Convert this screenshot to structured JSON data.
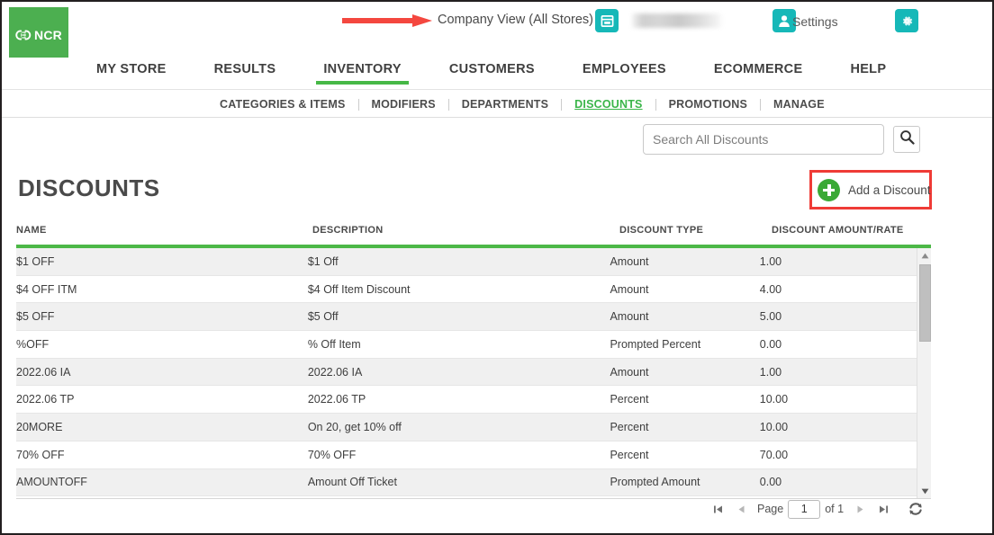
{
  "header": {
    "logo_text": "NCR",
    "company_view": "Company View (All Stores)",
    "store_name_redacted": "",
    "settings_label": "Settings",
    "icons": {
      "store": "store-icon",
      "person": "person-icon",
      "gear": "gear-icon",
      "arrow": "red-arrow-annotation"
    }
  },
  "main_nav": {
    "items": [
      {
        "label": "MY STORE",
        "active": false
      },
      {
        "label": "RESULTS",
        "active": false
      },
      {
        "label": "INVENTORY",
        "active": true
      },
      {
        "label": "CUSTOMERS",
        "active": false
      },
      {
        "label": "EMPLOYEES",
        "active": false
      },
      {
        "label": "ECOMMERCE",
        "active": false
      },
      {
        "label": "HELP",
        "active": false
      }
    ]
  },
  "sub_nav": {
    "items": [
      {
        "label": "CATEGORIES & ITEMS",
        "active": false
      },
      {
        "label": "MODIFIERS",
        "active": false
      },
      {
        "label": "DEPARTMENTS",
        "active": false
      },
      {
        "label": "DISCOUNTS",
        "active": true
      },
      {
        "label": "PROMOTIONS",
        "active": false
      },
      {
        "label": "MANAGE",
        "active": false
      }
    ]
  },
  "search": {
    "placeholder": "Search All Discounts",
    "value": "",
    "button_icon": "search-icon"
  },
  "page": {
    "title": "DISCOUNTS",
    "add_button_label": "Add a Discount"
  },
  "table": {
    "columns": [
      "NAME",
      "DESCRIPTION",
      "DISCOUNT TYPE",
      "DISCOUNT AMOUNT/RATE"
    ],
    "rows": [
      {
        "name": "$1 OFF",
        "description": "$1 Off",
        "type": "Amount",
        "amount": "1.00"
      },
      {
        "name": "$4 OFF ITM",
        "description": "$4 Off Item Discount",
        "type": "Amount",
        "amount": "4.00"
      },
      {
        "name": "$5 OFF",
        "description": "$5 Off",
        "type": "Amount",
        "amount": "5.00"
      },
      {
        "name": "%OFF",
        "description": "% Off Item",
        "type": "Prompted Percent",
        "amount": "0.00"
      },
      {
        "name": "2022.06 IA",
        "description": "2022.06 IA",
        "type": "Amount",
        "amount": "1.00"
      },
      {
        "name": "2022.06 TP",
        "description": "2022.06 TP",
        "type": "Percent",
        "amount": "10.00"
      },
      {
        "name": "20MORE",
        "description": "On 20, get 10% off",
        "type": "Percent",
        "amount": "10.00"
      },
      {
        "name": "70% OFF",
        "description": "70% OFF",
        "type": "Percent",
        "amount": "70.00"
      },
      {
        "name": "AMOUNTOFF",
        "description": "Amount Off Ticket",
        "type": "Prompted Amount",
        "amount": "0.00"
      }
    ]
  },
  "pagination": {
    "first_icon": "first-page-icon",
    "prev_icon": "previous-page-icon",
    "page_label": "Page",
    "page_value": "1",
    "of_label": "of 1",
    "next_icon": "next-page-icon",
    "last_icon": "last-page-icon",
    "refresh_icon": "refresh-icon"
  },
  "colors": {
    "brand_green": "#4cb847",
    "accent_teal": "#16b8b8",
    "annotation_red": "#ef3b36",
    "add_green": "#3aa935"
  }
}
